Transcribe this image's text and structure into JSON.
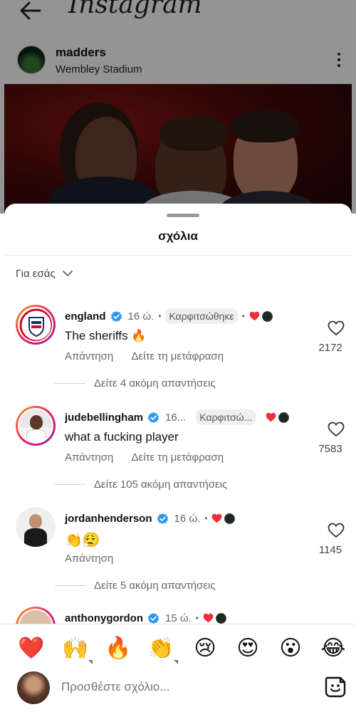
{
  "header": {
    "app_title": "Instagram",
    "author": "madders",
    "location": "Wembley Stadium"
  },
  "sheet": {
    "title": "σχόλια",
    "filter_label": "Για εσάς"
  },
  "comments": [
    {
      "username": "england",
      "time": "16 ώ.",
      "pinned": "Καρφιτσώθηκε",
      "text": "The sheriffs 🔥",
      "reply": "Απάντηση",
      "translate": "Δείτε τη μετάφραση",
      "likes": "2172",
      "more_replies": "Δείτε 4 ακόμη απαντήσεις"
    },
    {
      "username": "judebellingham",
      "time": "16...",
      "pinned": "Καρφιτσώ...",
      "text": "what a fucking player",
      "reply": "Απάντηση",
      "translate": "Δείτε τη μετάφραση",
      "likes": "7583",
      "more_replies": "Δείτε 105 ακόμη απαντήσεις"
    },
    {
      "username": "jordanhenderson",
      "time": "16 ώ.",
      "text": "👏😮‍💨",
      "reply": "Απάντηση",
      "likes": "1145",
      "more_replies": "Δείτε 5 ακόμη απαντήσεις"
    },
    {
      "username": "anthonygordon",
      "time": "15 ώ."
    }
  ],
  "emoji_bar": [
    "❤️",
    "🙌",
    "🔥",
    "👏",
    "😢",
    "😍",
    "😮",
    "😂"
  ],
  "composer": {
    "placeholder": "Προσθέστε σχόλιο..."
  },
  "colors": {
    "heart_red": "#ed2f3c",
    "verified_blue": "#2b96f0"
  },
  "icons": [
    "back-arrow-icon",
    "more-options-icon",
    "chevron-down-icon",
    "verified-badge-icon",
    "heart-icon",
    "sticker-icon"
  ]
}
